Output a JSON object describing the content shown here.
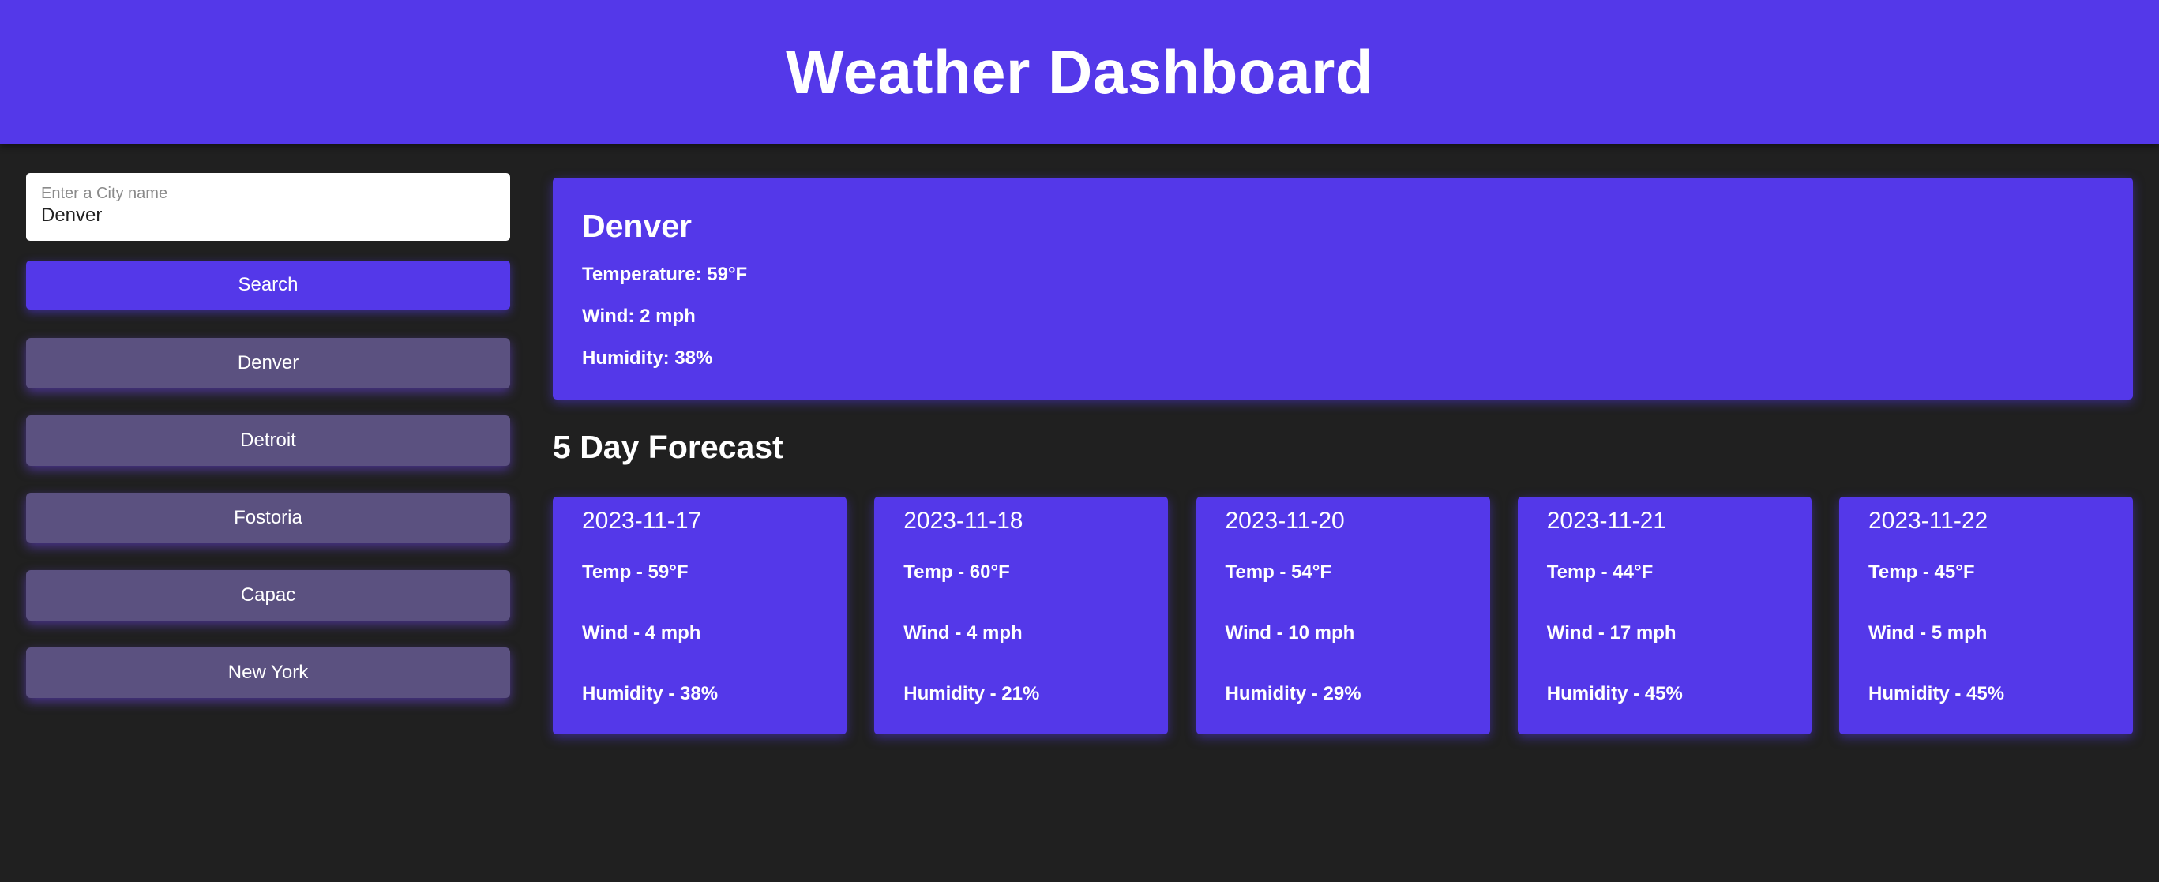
{
  "header": {
    "title": "Weather Dashboard"
  },
  "search": {
    "label": "Enter a City name",
    "value": "Denver",
    "button_label": "Search"
  },
  "history": [
    {
      "label": "Denver"
    },
    {
      "label": "Detroit"
    },
    {
      "label": "Fostoria"
    },
    {
      "label": "Capac"
    },
    {
      "label": "New York"
    }
  ],
  "current": {
    "city": "Denver",
    "temperature": "Temperature: 59°F",
    "wind": "Wind: 2 mph",
    "humidity": "Humidity: 38%"
  },
  "forecast": {
    "title": "5 Day Forecast",
    "days": [
      {
        "date": "2023-11-17",
        "temp": "Temp - 59°F",
        "wind": "Wind - 4 mph",
        "humidity": "Humidity - 38%"
      },
      {
        "date": "2023-11-18",
        "temp": "Temp - 60°F",
        "wind": "Wind - 4 mph",
        "humidity": "Humidity - 21%"
      },
      {
        "date": "2023-11-20",
        "temp": "Temp - 54°F",
        "wind": "Wind - 10 mph",
        "humidity": "Humidity - 29%"
      },
      {
        "date": "2023-11-21",
        "temp": "Temp - 44°F",
        "wind": "Wind - 17 mph",
        "humidity": "Humidity - 45%"
      },
      {
        "date": "2023-11-22",
        "temp": "Temp - 45°F",
        "wind": "Wind - 5 mph",
        "humidity": "Humidity - 45%"
      }
    ]
  },
  "colors": {
    "accent": "#5438e9",
    "background": "#202020",
    "history_button": "#5b5180"
  }
}
